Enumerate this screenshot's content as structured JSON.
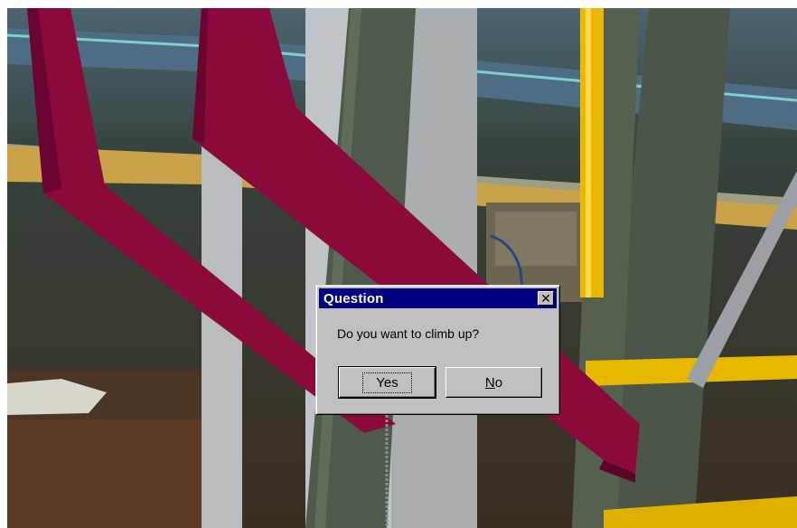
{
  "dialog": {
    "title": "Question",
    "message": "Do you want to climb up?",
    "yes_label": "Yes",
    "no_label": "No",
    "close_icon": "close-icon",
    "close_glyph": "✕"
  },
  "colors": {
    "titlebar": "#000080",
    "dialog_face": "#c0c0c0",
    "pipe": "#8a0a3c",
    "railing": "#e8b800"
  }
}
